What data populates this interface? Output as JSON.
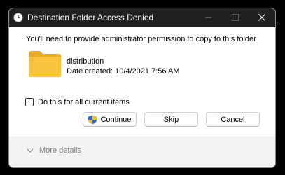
{
  "window": {
    "title": "Destination Folder Access Denied",
    "controls": {
      "minimize": "minimize",
      "maximize": "maximize",
      "close": "close"
    }
  },
  "dialog": {
    "message": "You'll need to provide administrator permission to copy to this folder",
    "item": {
      "name": "distribution",
      "date_created": "Date created: 10/4/2021 7:56 AM",
      "icon": "folder-icon"
    },
    "checkbox": {
      "label": "Do this for all current items",
      "checked": false
    },
    "buttons": {
      "continue": "Continue",
      "skip": "Skip",
      "cancel": "Cancel"
    },
    "footer": {
      "more_details": "More details"
    }
  },
  "colors": {
    "titlebar": "#202020",
    "folder": "#f8c43c",
    "footer": "#f3f3f3"
  }
}
